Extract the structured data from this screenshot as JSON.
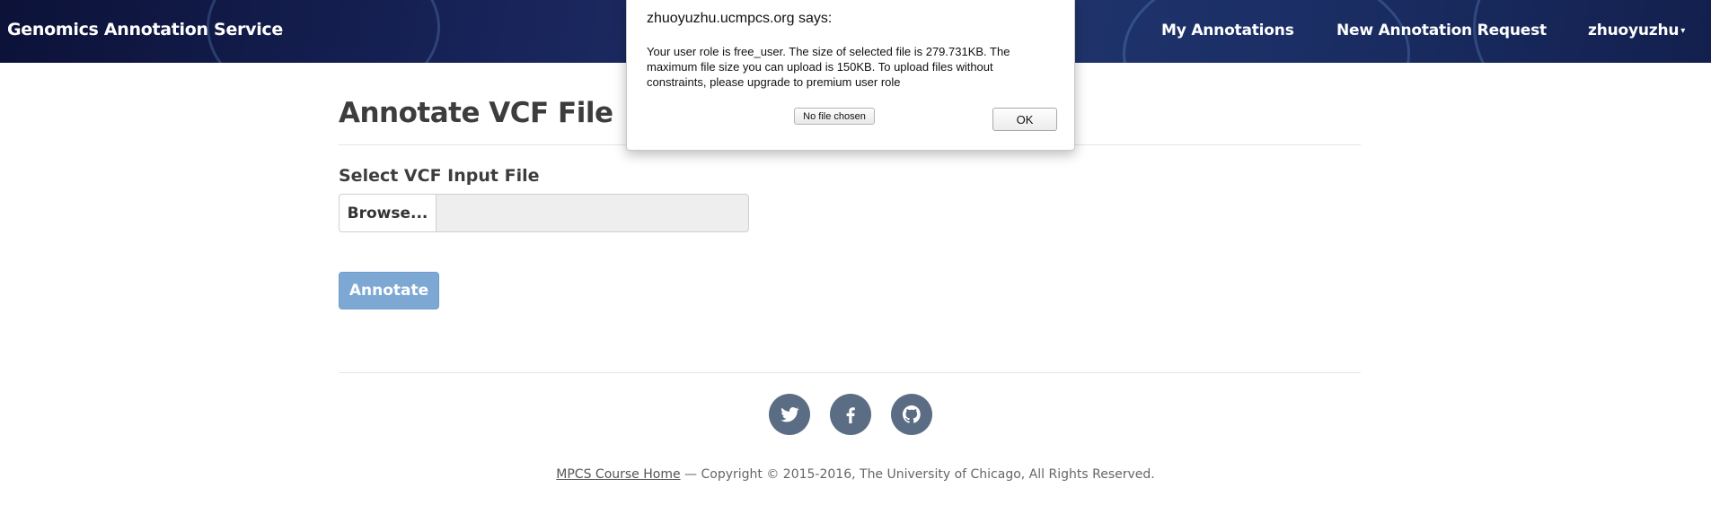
{
  "navbar": {
    "brand": "Genomics Annotation Service",
    "links": {
      "my_annotations": "My Annotations",
      "new_request": "New Annotation Request",
      "user": "zhuoyuzhu"
    }
  },
  "main": {
    "title": "Annotate VCF File",
    "file_label": "Select VCF Input File",
    "browse_label": "Browse...",
    "file_value": "",
    "annotate_label": "Annotate"
  },
  "social": {
    "icons": [
      "twitter-icon",
      "facebook-icon",
      "github-icon"
    ],
    "color": "#5b6d84"
  },
  "footer": {
    "link_text": "MPCS Course Home",
    "copyright": " — Copyright © 2015-2016, The University of Chicago, All Rights Reserved."
  },
  "dialog": {
    "title": "zhuoyuzhu.ucmpcs.org says:",
    "message": "Your user role is free_user. The size of selected file is 279.731KB. The maximum file size you can upload is 150KB. To upload files without constraints, please upgrade to premium user role",
    "no_file_label": "No file chosen",
    "ok_label": "OK"
  },
  "colors": {
    "navbar_dark": "#0c1238",
    "navbar_mid": "#22366e",
    "annotate_disabled": "#7da8d3"
  }
}
